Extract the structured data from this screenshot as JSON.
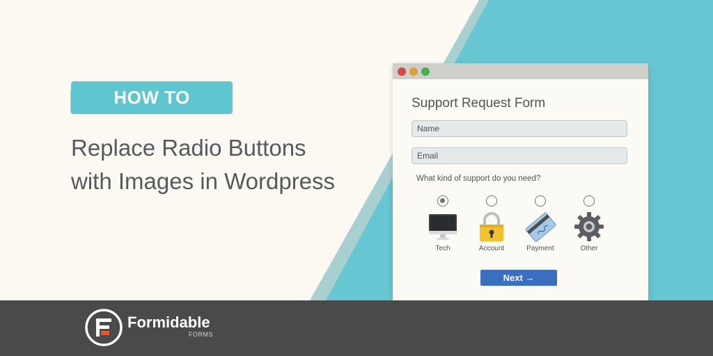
{
  "hero": {
    "tag": "HOW TO",
    "headline_line1": "Replace Radio Buttons",
    "headline_line2": "with Images in Wordpress"
  },
  "window": {
    "dot_colors": [
      "#d64a43",
      "#d8a13a",
      "#3db24c"
    ],
    "form_title": "Support Request Form",
    "name_placeholder": "Name",
    "email_placeholder": "Email",
    "question": "What kind of support do you need?",
    "options": [
      {
        "label": "Tech",
        "icon": "computer-icon",
        "selected": true
      },
      {
        "label": "Account",
        "icon": "padlock-icon",
        "selected": false
      },
      {
        "label": "Payment",
        "icon": "credit-card-icon",
        "selected": false
      },
      {
        "label": "Other",
        "icon": "gear-icon",
        "selected": false
      }
    ],
    "next_label": "Next →"
  },
  "footer": {
    "brand_name": "Formidable",
    "brand_sub": "FORMS"
  },
  "colors": {
    "teal": "#5fc5cf",
    "teal_light": "#a9d0d1",
    "button_blue": "#3a6fbf",
    "footer_bg": "#4a4a4a",
    "logo_orange": "#e8572b"
  }
}
